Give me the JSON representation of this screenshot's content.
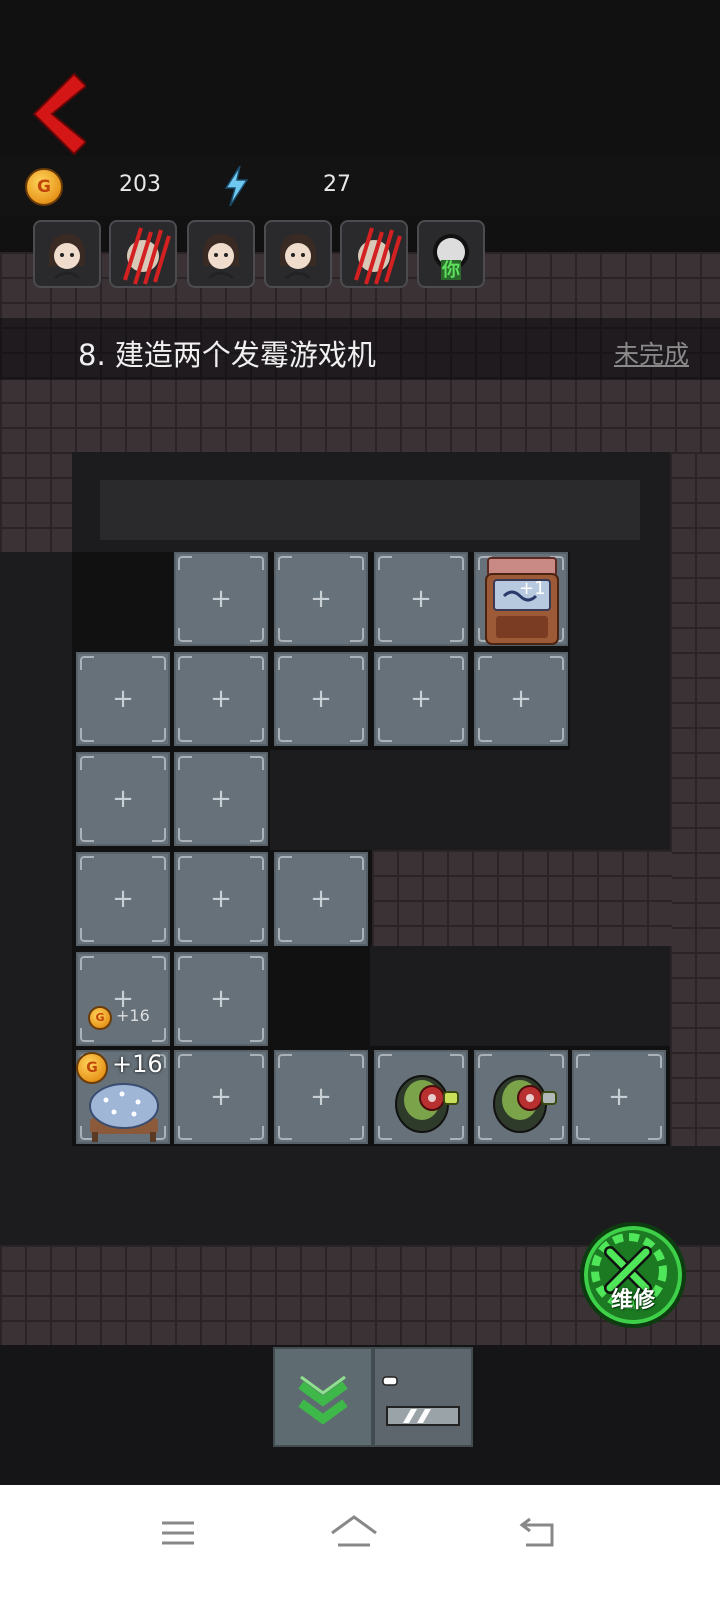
{
  "hud": {
    "coin_icon_letter": "G",
    "coins": "203",
    "energy": "27",
    "energy_icon": "lightning-bolt-icon"
  },
  "characters": [
    {
      "name": "girl-face-icon",
      "state": "normal"
    },
    {
      "name": "claw-scratch-icon",
      "state": "attacked"
    },
    {
      "name": "girl-face-icon",
      "state": "normal"
    },
    {
      "name": "girl-face-icon",
      "state": "normal"
    },
    {
      "name": "claw-scratch-icon",
      "state": "attacked"
    },
    {
      "name": "ghost-face-icon",
      "state": "player",
      "label": "你"
    }
  ],
  "task": {
    "text": "8. 建造两个发霉游戏机",
    "status": "未完成"
  },
  "floating": {
    "small_coin_text": "+16",
    "bed_coin_text": "+16",
    "arcade_text": "+1"
  },
  "tile_plus": "+",
  "buttons": {
    "repair_label": "维修"
  },
  "colors": {
    "back_arrow": "#d41616",
    "repair_green": "#1c7a22",
    "tile": "#667179"
  }
}
